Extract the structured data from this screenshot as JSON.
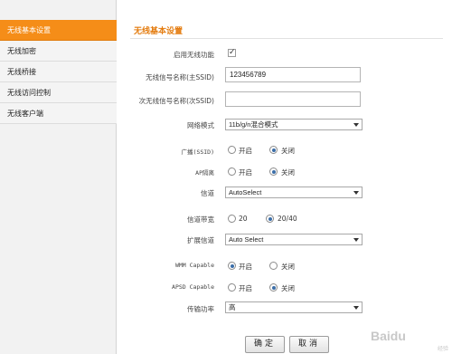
{
  "sidebar": {
    "items": [
      {
        "label": "无线基本设置",
        "active": true
      },
      {
        "label": "无线加密",
        "active": false
      },
      {
        "label": "无线桥接",
        "active": false
      },
      {
        "label": "无线访问控制",
        "active": false
      },
      {
        "label": "无线客户端",
        "active": false
      }
    ]
  },
  "main": {
    "section_title": "无线基本设置",
    "enable_wireless": {
      "label": "启用无线功能",
      "checked": true
    },
    "ssid": {
      "label": "无线信号名称(主SSID)",
      "value": "123456789"
    },
    "ssid2": {
      "label": "次无线信号名称(次SSID)",
      "value": ""
    },
    "network_mode": {
      "label": "网络模式",
      "value": "11b/g/n混合模式"
    },
    "broadcast": {
      "label": "广播(SSID)",
      "on_label": "开启",
      "off_label": "关闭",
      "selected": "off"
    },
    "ap_isolation": {
      "label": "AP隔离",
      "on_label": "开启",
      "off_label": "关闭",
      "selected": "off"
    },
    "channel": {
      "label": "信道",
      "value": "AutoSelect"
    },
    "bandwidth": {
      "label": "信道带宽",
      "opt1": "20",
      "opt2": "20/40",
      "selected": "20/40"
    },
    "ext_channel": {
      "label": "扩展信道",
      "value": "Auto Select"
    },
    "wmm": {
      "label": "WMM Capable",
      "on_label": "开启",
      "off_label": "关闭",
      "selected": "on"
    },
    "apsd": {
      "label": "APSD Capable",
      "on_label": "开启",
      "off_label": "关闭",
      "selected": "off"
    },
    "tx_power": {
      "label": "传输功率",
      "value": "高"
    },
    "ok_button": "确定",
    "cancel_button": "取消"
  },
  "watermark": {
    "text": "Baidu",
    "sub": "经验"
  },
  "colors": {
    "accent": "#f58d18",
    "title": "#e47c0f",
    "radio_dot": "#3b6ea8"
  }
}
